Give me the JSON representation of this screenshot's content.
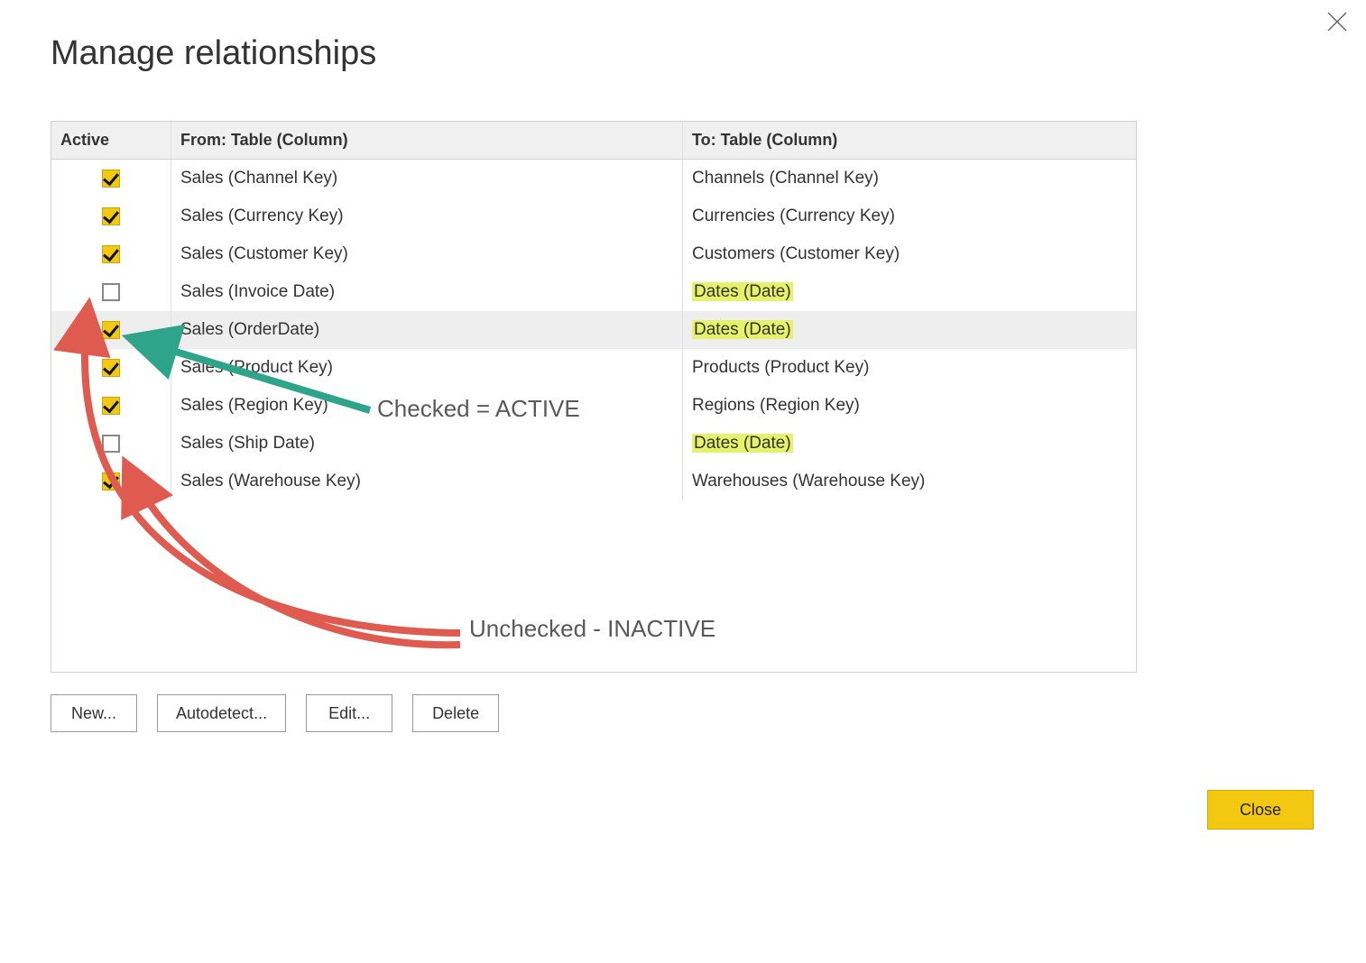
{
  "dialog": {
    "title": "Manage relationships"
  },
  "table": {
    "headers": {
      "active": "Active",
      "from": "From: Table (Column)",
      "to": "To: Table (Column)"
    },
    "rows": [
      {
        "active": true,
        "from": "Sales (Channel Key)",
        "to": "Channels (Channel Key)",
        "to_highlight": false,
        "selected": false
      },
      {
        "active": true,
        "from": "Sales (Currency Key)",
        "to": "Currencies (Currency Key)",
        "to_highlight": false,
        "selected": false
      },
      {
        "active": true,
        "from": "Sales (Customer Key)",
        "to": "Customers (Customer Key)",
        "to_highlight": false,
        "selected": false
      },
      {
        "active": false,
        "from": "Sales (Invoice Date)",
        "to": "Dates (Date)",
        "to_highlight": true,
        "selected": false
      },
      {
        "active": true,
        "from": "Sales (OrderDate)",
        "to": "Dates (Date)",
        "to_highlight": true,
        "selected": true
      },
      {
        "active": true,
        "from": "Sales (Product Key)",
        "to": "Products (Product Key)",
        "to_highlight": false,
        "selected": false
      },
      {
        "active": true,
        "from": "Sales (Region Key)",
        "to": "Regions (Region Key)",
        "to_highlight": false,
        "selected": false
      },
      {
        "active": false,
        "from": "Sales (Ship Date)",
        "to": "Dates (Date)",
        "to_highlight": true,
        "selected": false
      },
      {
        "active": true,
        "from": "Sales (Warehouse Key)",
        "to": "Warehouses (Warehouse Key)",
        "to_highlight": false,
        "selected": false
      }
    ]
  },
  "buttons": {
    "new": "New...",
    "autodetect": "Autodetect...",
    "edit": "Edit...",
    "delete": "Delete",
    "close": "Close"
  },
  "annotations": {
    "checked": "Checked = ACTIVE",
    "unchecked": "Unchecked - INACTIVE"
  },
  "colors": {
    "accent_yellow": "#f2c811",
    "highlight": "#e6f26a",
    "arrow_red": "#e05b4f",
    "arrow_green": "#2ea58a"
  }
}
